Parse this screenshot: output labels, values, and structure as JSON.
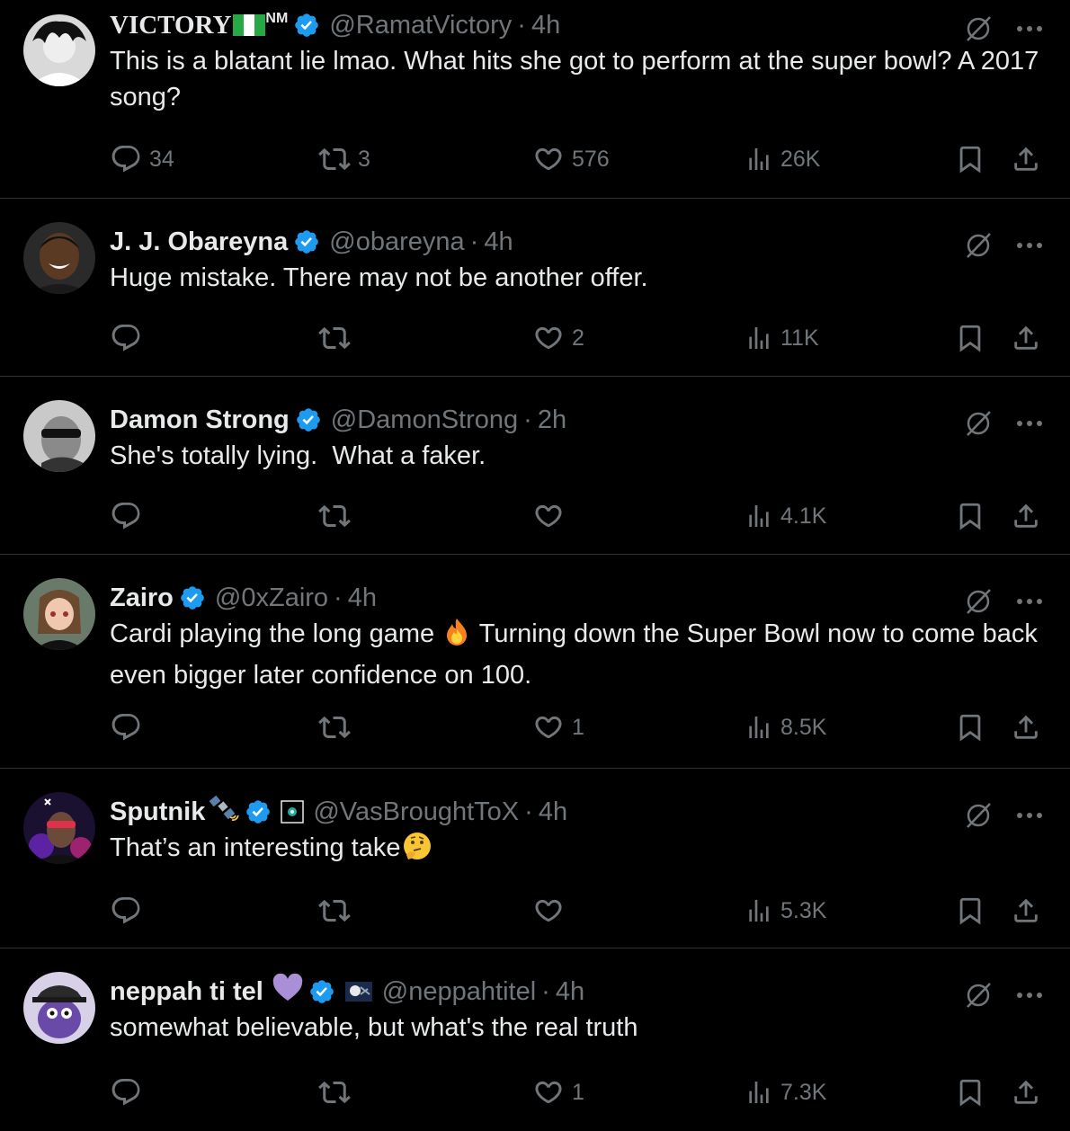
{
  "tweets": [
    {
      "name": "VICTORY",
      "name_suffix": "NM",
      "handle": "@RamatVictory",
      "time": "4h",
      "text": "This is a blatant lie lmao. What hits she got to perform at the super bowl? A 2017 song?",
      "replies": "34",
      "reposts": "3",
      "likes": "576",
      "views": "26K"
    },
    {
      "name": "J. J. Obareyna",
      "handle": "@obareyna",
      "time": "4h",
      "text": "Huge mistake. There may not be another offer.",
      "replies": "",
      "reposts": "",
      "likes": "2",
      "views": "11K"
    },
    {
      "name": "Damon Strong",
      "handle": "@DamonStrong",
      "time": "2h",
      "text": "She's totally lying.  What a faker.",
      "replies": "",
      "reposts": "",
      "likes": "",
      "views": "4.1K"
    },
    {
      "name": "Zairo",
      "handle": "@0xZairo",
      "time": "4h",
      "text_a": "Cardi playing the long game ",
      "text_b": " Turning down the Super Bowl now to come back even bigger later confidence on 100.",
      "replies": "",
      "reposts": "",
      "likes": "1",
      "views": "8.5K"
    },
    {
      "name": "Sputnik",
      "handle": "@VasBroughtToX",
      "time": "4h",
      "text": "That’s an interesting take",
      "replies": "",
      "reposts": "",
      "likes": "",
      "views": "5.3K"
    },
    {
      "name": "neppah ti tel",
      "handle": "@neppahtitel",
      "time": "4h",
      "text": "somewhat believable, but what's the real truth",
      "replies": "",
      "reposts": "",
      "likes": "1",
      "views": "7.3K"
    }
  ],
  "colors": {
    "background": "#000000",
    "text": "#e7e9ea",
    "muted": "#71767b",
    "verified": "#1d9bf0",
    "divider": "#2f3336"
  },
  "icons": [
    "reply-icon",
    "repost-icon",
    "like-icon",
    "views-icon",
    "bookmark-icon",
    "share-icon",
    "grok-icon",
    "more-icon",
    "verified-icon"
  ]
}
